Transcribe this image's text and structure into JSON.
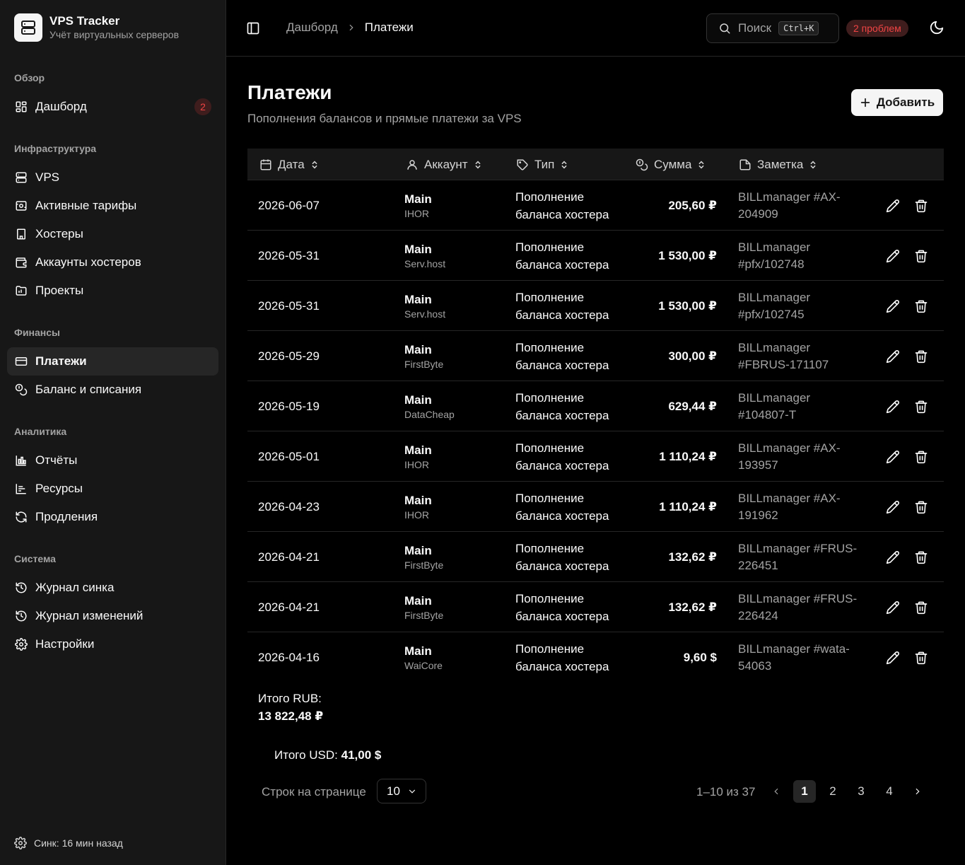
{
  "brand": {
    "title": "VPS Tracker",
    "subtitle": "Учёт виртуальных серверов"
  },
  "sidebar": {
    "groups": [
      {
        "label": "Обзор"
      },
      {
        "label": "Инфраструктура"
      },
      {
        "label": "Финансы"
      },
      {
        "label": "Аналитика"
      },
      {
        "label": "Система"
      }
    ],
    "items": {
      "dashboard": {
        "label": "Дашборд",
        "badge": "2",
        "icon": "layout-grid-icon"
      },
      "vps": {
        "label": "VPS",
        "icon": "server-icon"
      },
      "tariffs": {
        "label": "Активные тарифы",
        "icon": "tariff-icon"
      },
      "hosters": {
        "label": "Хостеры",
        "icon": "building-icon"
      },
      "hoster_accounts": {
        "label": "Аккаунты хостеров",
        "icon": "wallet-icon"
      },
      "projects": {
        "label": "Проекты",
        "icon": "folder-icon"
      },
      "payments": {
        "label": "Платежи",
        "icon": "credit-card-icon",
        "active": true
      },
      "balance": {
        "label": "Баланс и списания",
        "icon": "coins-icon"
      },
      "reports": {
        "label": "Отчёты",
        "icon": "bar-chart-icon"
      },
      "resources": {
        "label": "Ресурсы",
        "icon": "resources-chart-icon"
      },
      "renewals": {
        "label": "Продления",
        "icon": "refresh-icon"
      },
      "sync_log": {
        "label": "Журнал синка",
        "icon": "history-icon"
      },
      "change_log": {
        "label": "Журнал изменений",
        "icon": "history-icon"
      },
      "settings": {
        "label": "Настройки",
        "icon": "gear-icon"
      }
    },
    "sync_status": "Синк: 16 мин назад"
  },
  "header": {
    "breadcrumb": {
      "parent": "Дашборд",
      "current": "Платежи"
    },
    "search": {
      "label": "Поиск",
      "shortcut": "Ctrl+K"
    },
    "problems_badge": "2 проблем"
  },
  "page": {
    "title": "Платежи",
    "subtitle": "Пополнения балансов и прямые платежи за VPS",
    "add_label": "Добавить"
  },
  "table": {
    "columns": {
      "date": "Дата",
      "account": "Аккаунт",
      "type": "Тип",
      "amount": "Сумма",
      "note": "Заметка"
    },
    "rows": [
      {
        "date": "2026-06-07",
        "account": "Main",
        "hoster": "IHOR",
        "type": "Пополнение баланса хостера",
        "amount": "205,60 ₽",
        "note": "BILLmanager #AX-204909"
      },
      {
        "date": "2026-05-31",
        "account": "Main",
        "hoster": "Serv.host",
        "type": "Пополнение баланса хостера",
        "amount": "1 530,00 ₽",
        "note": "BILLmanager #pfx/102748"
      },
      {
        "date": "2026-05-31",
        "account": "Main",
        "hoster": "Serv.host",
        "type": "Пополнение баланса хостера",
        "amount": "1 530,00 ₽",
        "note": "BILLmanager #pfx/102745"
      },
      {
        "date": "2026-05-29",
        "account": "Main",
        "hoster": "FirstByte",
        "type": "Пополнение баланса хостера",
        "amount": "300,00 ₽",
        "note": "BILLmanager #FBRUS-171107"
      },
      {
        "date": "2026-05-19",
        "account": "Main",
        "hoster": "DataCheap",
        "type": "Пополнение баланса хостера",
        "amount": "629,44 ₽",
        "note": "BILLmanager #104807-T"
      },
      {
        "date": "2026-05-01",
        "account": "Main",
        "hoster": "IHOR",
        "type": "Пополнение баланса хостера",
        "amount": "1 110,24 ₽",
        "note": "BILLmanager #AX-193957"
      },
      {
        "date": "2026-04-23",
        "account": "Main",
        "hoster": "IHOR",
        "type": "Пополнение баланса хостера",
        "amount": "1 110,24 ₽",
        "note": "BILLmanager #AX-191962"
      },
      {
        "date": "2026-04-21",
        "account": "Main",
        "hoster": "FirstByte",
        "type": "Пополнение баланса хостера",
        "amount": "132,62 ₽",
        "note": "BILLmanager #FRUS-226451"
      },
      {
        "date": "2026-04-21",
        "account": "Main",
        "hoster": "FirstByte",
        "type": "Пополнение баланса хостера",
        "amount": "132,62 ₽",
        "note": "BILLmanager #FRUS-226424"
      },
      {
        "date": "2026-04-16",
        "account": "Main",
        "hoster": "WaiCore",
        "type": "Пополнение баланса хостера",
        "amount": "9,60 $",
        "note": "BILLmanager #wata-54063"
      }
    ]
  },
  "totals": {
    "rub_label": "Итого RUB:",
    "rub_value": "13 822,48 ₽",
    "usd_label": "Итого USD:",
    "usd_value": "41,00 $"
  },
  "pagination": {
    "rows_per_page_label": "Строк на странице",
    "rows_per_page_value": "10",
    "range": "1–10 из 37",
    "pages": [
      "1",
      "2",
      "3",
      "4"
    ],
    "current_page": "1"
  }
}
